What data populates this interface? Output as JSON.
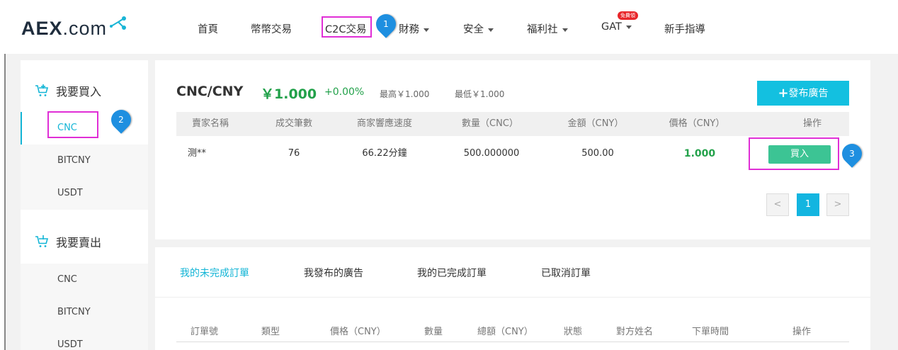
{
  "brand": {
    "logo_main": "AEX",
    "logo_suffix": ".com"
  },
  "nav": {
    "items": [
      {
        "label": "首頁"
      },
      {
        "label": "幣幣交易"
      },
      {
        "label": "C2C交易"
      },
      {
        "label": "財務"
      },
      {
        "label": "安全"
      },
      {
        "label": "福利社"
      },
      {
        "label": "GAT"
      },
      {
        "label": "新手指導"
      }
    ],
    "gat_badge": "免費領"
  },
  "markers": [
    "1",
    "2",
    "3"
  ],
  "sidebar": {
    "buy_title": "我要買入",
    "buy_items": [
      "CNC",
      "BITCNY",
      "USDT"
    ],
    "sell_title": "我要賣出",
    "sell_items": [
      "CNC",
      "BITCNY",
      "USDT"
    ]
  },
  "market": {
    "pair": "CNC/CNY",
    "price": "￥1.000",
    "change": "+0.00%",
    "high": "最高￥1.000",
    "low": "最低￥1.000",
    "publish_label": "發布廣告"
  },
  "ads_table": {
    "headers": [
      "賣家名稱",
      "成交筆數",
      "商家響應速度",
      "數量（CNC）",
      "金額（CNY）",
      "價格（CNY）",
      "操作"
    ],
    "rows": [
      {
        "seller": "测**",
        "trades": "76",
        "speed": "66.22分鐘",
        "amount": "500.000000",
        "total": "500.00",
        "price": "1.000",
        "action": "買入"
      }
    ]
  },
  "pagination": {
    "prev": "<",
    "current": "1",
    "next": ">"
  },
  "orders": {
    "tabs": [
      "我的未完成訂單",
      "我發布的廣告",
      "我的已完成訂單",
      "已取消訂單"
    ],
    "headers": [
      "訂單號",
      "類型",
      "價格（CNY）",
      "數量",
      "總額（CNY）",
      "狀態",
      "對方姓名",
      "下單時間",
      "操作"
    ]
  },
  "colors": {
    "accent": "#13b5d6",
    "price_green": "#22a14a",
    "buy_button": "#3cc494",
    "highlight": "#e02fd6",
    "marker": "#1e8fe0"
  }
}
